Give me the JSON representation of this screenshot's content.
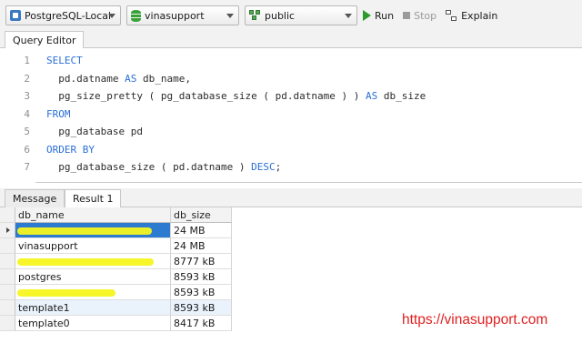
{
  "toolbar": {
    "connection": "PostgreSQL-Local",
    "database": "vinasupport",
    "schema": "public",
    "run_label": "Run",
    "stop_label": "Stop",
    "explain_label": "Explain"
  },
  "editor": {
    "tab_label": "Query Editor",
    "lines": [
      {
        "n": "1",
        "parts": [
          {
            "t": "SELECT",
            "kw": true
          }
        ]
      },
      {
        "n": "2",
        "parts": [
          {
            "t": "  pd.datname ",
            "kw": false
          },
          {
            "t": "AS",
            "kw": true
          },
          {
            "t": " db_name,",
            "kw": false
          }
        ]
      },
      {
        "n": "3",
        "parts": [
          {
            "t": "  pg_size_pretty ( pg_database_size ( pd.datname ) ) ",
            "kw": false
          },
          {
            "t": "AS",
            "kw": true
          },
          {
            "t": " db_size",
            "kw": false
          }
        ]
      },
      {
        "n": "4",
        "parts": [
          {
            "t": "FROM",
            "kw": true
          }
        ]
      },
      {
        "n": "5",
        "parts": [
          {
            "t": "  pg_database pd",
            "kw": false
          }
        ]
      },
      {
        "n": "6",
        "parts": [
          {
            "t": "ORDER BY",
            "kw": true
          }
        ]
      },
      {
        "n": "7",
        "parts": [
          {
            "t": "  pg_database_size ( pd.datname ) ",
            "kw": false
          },
          {
            "t": "DESC",
            "kw": true
          },
          {
            "t": ";",
            "kw": false
          }
        ]
      }
    ]
  },
  "results": {
    "tabs": [
      {
        "label": "Message",
        "active": false
      },
      {
        "label": "Result 1",
        "active": true
      }
    ],
    "columns": [
      "db_name",
      "db_size"
    ],
    "rows": [
      {
        "db_name": "",
        "db_size": "24 MB",
        "redacted": true,
        "selected": true
      },
      {
        "db_name": "vinasupport",
        "db_size": "24 MB",
        "redacted": false,
        "selected": false
      },
      {
        "db_name": "",
        "db_size": "8777 kB",
        "redacted": true,
        "selected": false
      },
      {
        "db_name": "postgres",
        "db_size": "8593 kB",
        "redacted": false,
        "selected": false
      },
      {
        "db_name": "",
        "db_size": "8593 kB",
        "redacted": true,
        "selected": false
      },
      {
        "db_name": "template1",
        "db_size": "8593 kB",
        "redacted": false,
        "selected": false
      },
      {
        "db_name": "template0",
        "db_size": "8417 kB",
        "redacted": false,
        "selected": false
      }
    ]
  },
  "watermark": "https://vinasupport.com",
  "colors": {
    "keyword": "#2a6fd6",
    "selection": "#2d7ad1",
    "redaction": "#f5f51f",
    "watermark": "#e02020",
    "run": "#2c9a2c"
  }
}
